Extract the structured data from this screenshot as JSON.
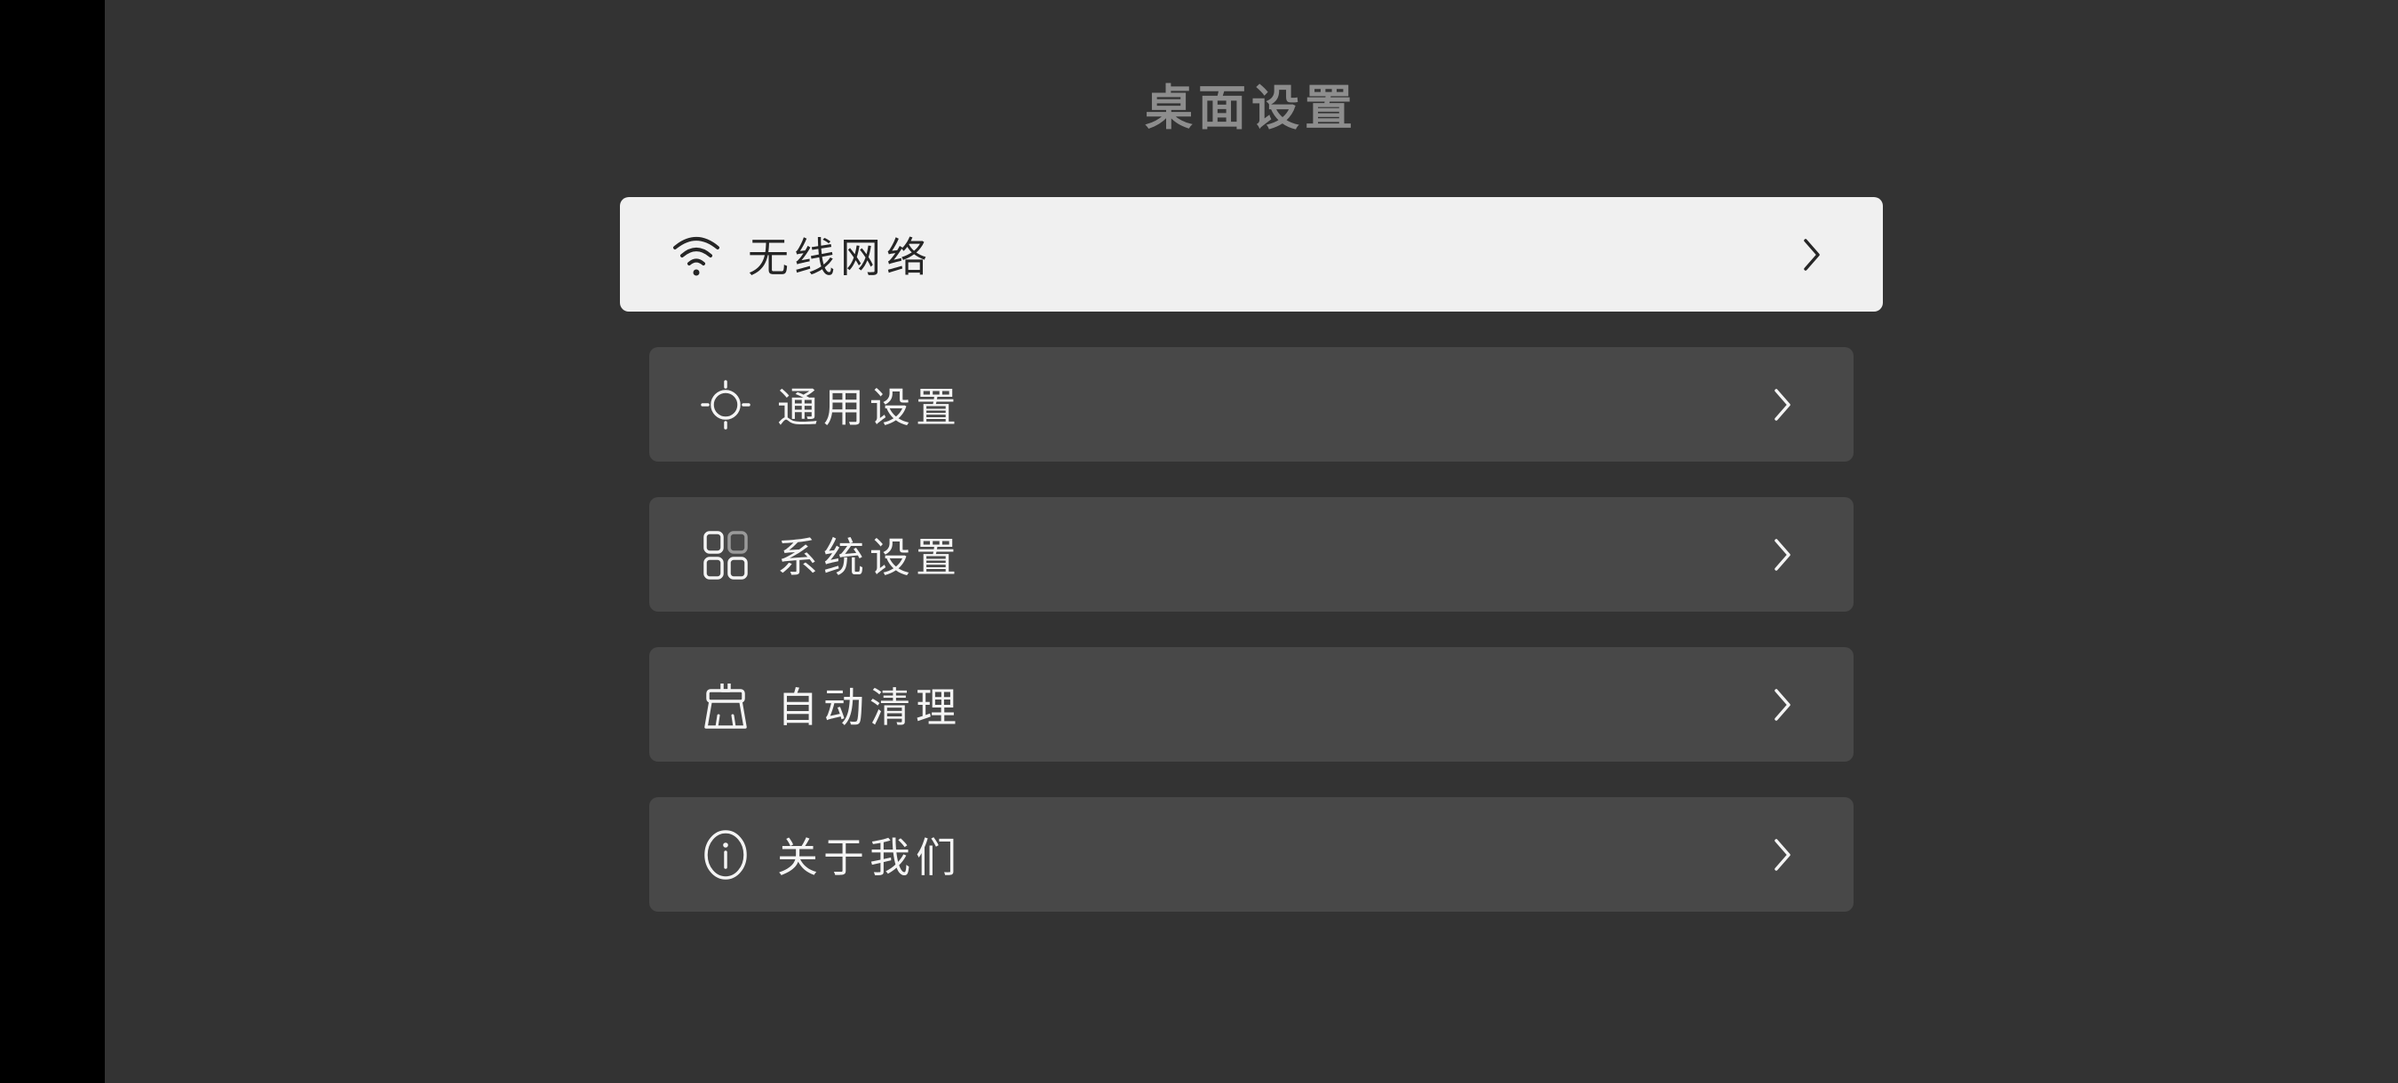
{
  "page": {
    "title": "桌面设置"
  },
  "menu": {
    "items": [
      {
        "label": "无线网络",
        "icon": "wifi-icon",
        "focused": true
      },
      {
        "label": "通用设置",
        "icon": "sun-icon",
        "focused": false
      },
      {
        "label": "系统设置",
        "icon": "apps-grid-icon",
        "focused": false
      },
      {
        "label": "自动清理",
        "icon": "broom-icon",
        "focused": false
      },
      {
        "label": "关于我们",
        "icon": "info-icon",
        "focused": false
      }
    ],
    "chevron_icon": "chevron-right-icon"
  },
  "colors": {
    "background": "#333333",
    "left_strip": "#000000",
    "item_background": "#484848",
    "item_focused_background": "#f0f0f0",
    "title_color": "#8d8d8d",
    "text_light": "#f4f4f4",
    "text_dark": "#262626"
  }
}
